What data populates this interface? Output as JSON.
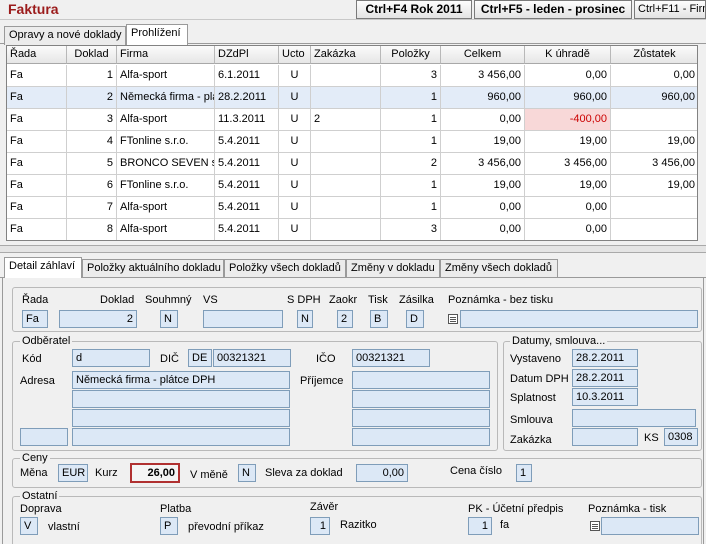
{
  "app_title": "Faktura",
  "top_buttons": [
    "Ctrl+F4 Rok 2011",
    "Ctrl+F5 - leden - prosinec",
    "Ctrl+F11 - Firm"
  ],
  "tabs": [
    "Opravy a nové doklady",
    "Prohlížení"
  ],
  "grid": {
    "columns": [
      "Řada",
      "Doklad",
      "Firma",
      "DZdPl",
      "Ucto",
      "Zakázka",
      "Položky",
      "Celkem",
      "K úhradě",
      "Zůstatek"
    ],
    "rows": [
      [
        "Fa",
        "1",
        "Alfa-sport",
        "6.1.2011",
        "U",
        "",
        "3",
        "3 456,00",
        "0,00",
        "0,00"
      ],
      [
        "Fa",
        "2",
        "Německá firma - plá",
        "28.2.2011",
        "U",
        "",
        "1",
        "960,00",
        "960,00",
        "960,00"
      ],
      [
        "Fa",
        "3",
        "Alfa-sport",
        "11.3.2011",
        "U",
        "2",
        "1",
        "0,00",
        "-400,00",
        ""
      ],
      [
        "Fa",
        "4",
        "FTonline s.r.o.",
        "5.4.2011",
        "U",
        "",
        "1",
        "19,00",
        "19,00",
        "19,00"
      ],
      [
        "Fa",
        "5",
        "BRONCO SEVEN s",
        "5.4.2011",
        "U",
        "",
        "2",
        "3 456,00",
        "3 456,00",
        "3 456,00"
      ],
      [
        "Fa",
        "6",
        "FTonline s.r.o.",
        "5.4.2011",
        "U",
        "",
        "1",
        "19,00",
        "19,00",
        "19,00"
      ],
      [
        "Fa",
        "7",
        "Alfa-sport",
        "5.4.2011",
        "U",
        "",
        "1",
        "0,00",
        "0,00",
        ""
      ],
      [
        "Fa",
        "8",
        "Alfa-sport",
        "5.4.2011",
        "U",
        "",
        "3",
        "0,00",
        "0,00",
        ""
      ]
    ],
    "selected_row": 1,
    "colors": {
      "selected_row": "#e3ecf8",
      "negative_cell": "#f8d8d8",
      "negative_text": "#cc0000"
    }
  },
  "detail_tabs": [
    "Detail záhlaví",
    "Položky aktuálního dokladu",
    "Položky všech dokladů",
    "Změny v dokladu",
    "Změny všech dokladů"
  ],
  "header": {
    "labels": {
      "rada": "Řada",
      "doklad": "Doklad",
      "souhmny": "Souhmný",
      "vs": "VS",
      "sdph": "S DPH",
      "zaokr": "Zaokr",
      "tisk": "Tisk",
      "zasilka": "Zásilka",
      "poznamka": "Poznámka - bez tisku"
    },
    "values": {
      "rada": "Fa",
      "doklad": "2",
      "souhmny": "N",
      "vs": "",
      "sdph": "N",
      "zaokr": "2",
      "tisk": "B",
      "zasilka": "D",
      "poznamka": ""
    }
  },
  "odberatel": {
    "legend": "Odběratel",
    "labels": {
      "kod": "Kód",
      "dic": "DIČ",
      "ico": "IČO",
      "adresa": "Adresa",
      "prijemce": "Příjemce"
    },
    "values": {
      "kod": "d",
      "dic_prefix": "DE",
      "dic": "00321321",
      "ico": "00321321",
      "adresa": [
        "Německá firma - plátce DPH",
        "",
        "",
        ""
      ],
      "adresa_extra": "",
      "prijemce": [
        "",
        "",
        "",
        ""
      ]
    }
  },
  "datumy": {
    "legend": "Datumy, smlouva...",
    "labels": {
      "vystaveno": "Vystaveno",
      "datum_dph": "Datum DPH",
      "splatnost": "Splatnost",
      "smlouva": "Smlouva",
      "zakazka": "Zakázka",
      "ks": "KS"
    },
    "values": {
      "vystaveno": "28.2.2011",
      "datum_dph": "28.2.2011",
      "splatnost": "10.3.2011",
      "smlouva": "",
      "zakazka": "",
      "ks": "0308"
    }
  },
  "ceny": {
    "legend": "Ceny",
    "labels": {
      "mena": "Měna",
      "kurz": "Kurz",
      "v_mene": "V měně",
      "sleva": "Sleva za doklad",
      "cena_cislo": "Cena číslo"
    },
    "values": {
      "mena": "EUR",
      "kurz": "26,00",
      "v_mene": "N",
      "sleva": "0,00",
      "cena_cislo": "1"
    }
  },
  "ostatni": {
    "legend": "Ostatní",
    "labels": {
      "doprava": "Doprava",
      "platba": "Platba",
      "zaver": "Závěr",
      "pk": "PK - Účetní předpis",
      "poznamka_tisk": "Poznámka - tisk"
    },
    "values": {
      "doprava_code": "V",
      "doprava_text": "vlastní",
      "platba_code": "P",
      "platba_text": "převodní příkaz",
      "zaver_code": "1",
      "zaver_text": "Razitko",
      "pk_code": "1",
      "pk_text": "fa",
      "poznamka_tisk": ""
    }
  }
}
